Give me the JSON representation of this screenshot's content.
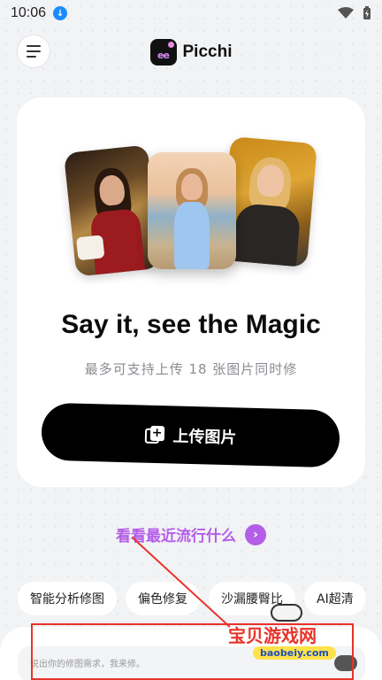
{
  "status_bar": {
    "time": "10:06",
    "download_icon": "download-arrow-icon",
    "wifi_icon": "wifi-icon",
    "battery_icon": "battery-charging-icon"
  },
  "header": {
    "brand": "Picchi",
    "menu_icon": "hamburger-menu-icon",
    "logo_icon": "picchi-logo-icon"
  },
  "hero": {
    "headline": "Say it, see the Magic",
    "subline": "最多可支持上传 18 张图片同时修",
    "upload_label": "上传图片"
  },
  "trending": {
    "label": "看看最近流行什么",
    "arrow_icon": "chevron-right-icon"
  },
  "chips": [
    {
      "label": "智能分析修图"
    },
    {
      "label": "偏色修复"
    },
    {
      "label": "沙漏腰臀比"
    },
    {
      "label": "AI超清"
    }
  ],
  "prompt": {
    "placeholder": "说出你的修图需求，我来修。"
  },
  "watermark": {
    "title": "宝贝游戏网",
    "url": "baobeiy.com"
  },
  "colors": {
    "accent": "#b45ee8",
    "button": "#000000",
    "background": "#f2f3f5",
    "card": "#ffffff",
    "watermark_red": "#e8332a"
  }
}
